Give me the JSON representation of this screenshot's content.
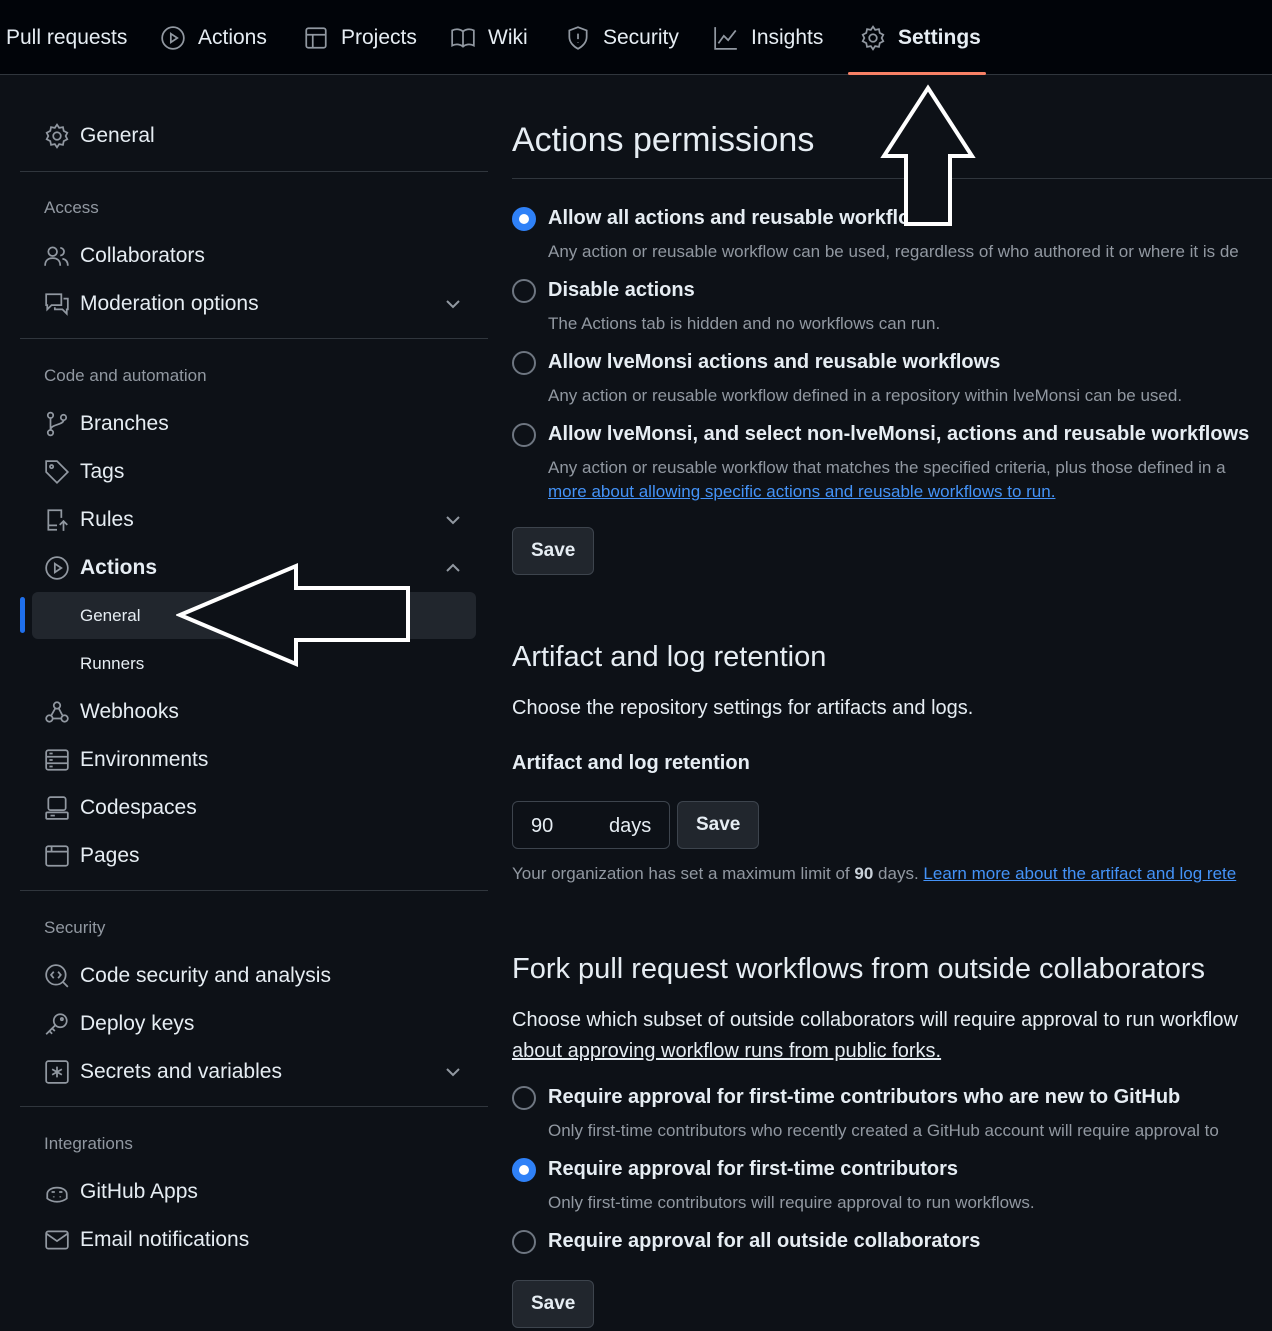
{
  "topnav": {
    "tabs": [
      {
        "label": "Pull requests",
        "icon": "pull-request-icon"
      },
      {
        "label": "Actions",
        "icon": "play-icon"
      },
      {
        "label": "Projects",
        "icon": "table-icon"
      },
      {
        "label": "Wiki",
        "icon": "book-icon"
      },
      {
        "label": "Security",
        "icon": "shield-icon"
      },
      {
        "label": "Insights",
        "icon": "graph-icon"
      },
      {
        "label": "Settings",
        "icon": "gear-icon",
        "selected": true
      }
    ]
  },
  "sidebar": {
    "general": "General",
    "access_title": "Access",
    "collaborators": "Collaborators",
    "moderation": "Moderation options",
    "code_title": "Code and automation",
    "branches": "Branches",
    "tags": "Tags",
    "rules": "Rules",
    "actions": "Actions",
    "actions_general": "General",
    "actions_runners": "Runners",
    "webhooks": "Webhooks",
    "environments": "Environments",
    "codespaces": "Codespaces",
    "pages": "Pages",
    "security_title": "Security",
    "code_security": "Code security and analysis",
    "deploy_keys": "Deploy keys",
    "secrets": "Secrets and variables",
    "integrations_title": "Integrations",
    "github_apps": "GitHub Apps",
    "email_notifications": "Email notifications"
  },
  "permissions": {
    "title": "Actions permissions",
    "options": [
      {
        "label": "Allow all actions and reusable workflows",
        "desc": "Any action or reusable workflow can be used, regardless of who authored it or where it is de",
        "checked": true
      },
      {
        "label": "Disable actions",
        "desc": "The Actions tab is hidden and no workflows can run.",
        "checked": false
      },
      {
        "label": "Allow lveMonsi actions and reusable workflows",
        "desc": "Any action or reusable workflow defined in a repository within lveMonsi can be used.",
        "checked": false
      },
      {
        "label": "Allow lveMonsi, and select non-lveMonsi, actions and reusable workflows",
        "desc": "Any action or reusable workflow that matches the specified criteria, plus those defined in a",
        "checked": false
      }
    ],
    "option4_link": "more about allowing specific actions and reusable workflows to run.",
    "save": "Save"
  },
  "retention": {
    "title": "Artifact and log retention",
    "desc": "Choose the repository settings for artifacts and logs.",
    "field_label": "Artifact and log retention",
    "value": "90",
    "unit": "days",
    "save": "Save",
    "hint_prefix": "Your organization has set a maximum limit of",
    "hint_value": "90",
    "hint_suffix": "days.",
    "hint_link": "Learn more about the artifact and log rete"
  },
  "fork": {
    "title": "Fork pull request workflows from outside collaborators",
    "desc": "Choose which subset of outside collaborators will require approval to run workflow",
    "desc_link": "about approving workflow runs from public forks.",
    "options": [
      {
        "label": "Require approval for first-time contributors who are new to GitHub",
        "desc": "Only first-time contributors who recently created a GitHub account will require approval to",
        "checked": false
      },
      {
        "label": "Require approval for first-time contributors",
        "desc": "Only first-time contributors will require approval to run workflows.",
        "checked": true
      },
      {
        "label": "Require approval for all outside collaborators",
        "desc": "",
        "checked": false
      }
    ],
    "save": "Save"
  },
  "colors": {
    "background": "#0d1117",
    "accent": "#2f81f7",
    "tab_underline": "#f78166",
    "link": "#4493f8"
  }
}
